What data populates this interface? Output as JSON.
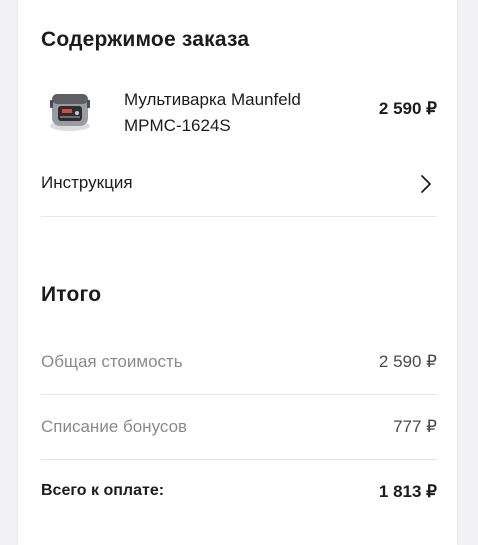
{
  "order": {
    "title": "Содержимое заказа",
    "product": {
      "name": "Мультиварка Maunfeld MPMC-1624S",
      "price": "2 590 ₽",
      "image_icon": "multicooker-icon"
    },
    "instruction_label": "Инструкция"
  },
  "total": {
    "title": "Итого",
    "rows": [
      {
        "label": "Общая стоимость",
        "value": "2 590 ₽"
      },
      {
        "label": "Списание бонусов",
        "value": "777 ₽"
      },
      {
        "label": "Всего к оплате:",
        "value": "1 813 ₽"
      }
    ]
  }
}
